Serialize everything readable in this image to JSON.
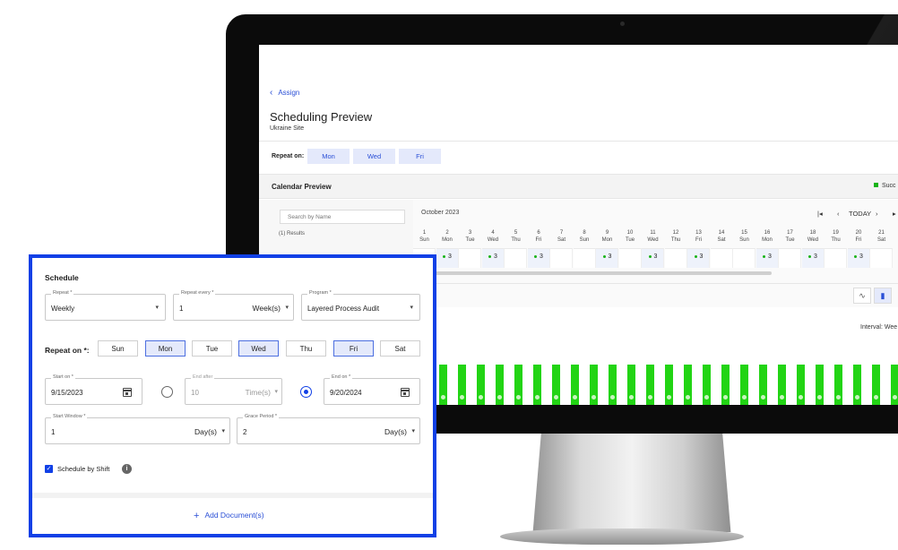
{
  "screen": {
    "back_link": "Assign",
    "title": "Scheduling Preview",
    "subtitle": "Ukraine Site",
    "repeat_label": "Repeat on:",
    "repeat_days": [
      "Mon",
      "Wed",
      "Fri"
    ],
    "calendar_preview_title": "Calendar Preview",
    "legend": "Succ",
    "search_placeholder": "Search by Name",
    "results": "(1) Results",
    "month": "October 2023",
    "today": "TODAY",
    "days": [
      {
        "n": "1",
        "w": "Sun",
        "c": ""
      },
      {
        "n": "2",
        "w": "Mon",
        "c": "3"
      },
      {
        "n": "3",
        "w": "Tue",
        "c": ""
      },
      {
        "n": "4",
        "w": "Wed",
        "c": "3"
      },
      {
        "n": "5",
        "w": "Thu",
        "c": ""
      },
      {
        "n": "6",
        "w": "Fri",
        "c": "3"
      },
      {
        "n": "7",
        "w": "Sat",
        "c": ""
      },
      {
        "n": "8",
        "w": "Sun",
        "c": ""
      },
      {
        "n": "9",
        "w": "Mon",
        "c": "3"
      },
      {
        "n": "10",
        "w": "Tue",
        "c": ""
      },
      {
        "n": "11",
        "w": "Wed",
        "c": "3"
      },
      {
        "n": "12",
        "w": "Thu",
        "c": ""
      },
      {
        "n": "13",
        "w": "Fri",
        "c": "3"
      },
      {
        "n": "14",
        "w": "Sat",
        "c": ""
      },
      {
        "n": "15",
        "w": "Sun",
        "c": ""
      },
      {
        "n": "16",
        "w": "Mon",
        "c": "3"
      },
      {
        "n": "17",
        "w": "Tue",
        "c": ""
      },
      {
        "n": "18",
        "w": "Wed",
        "c": "3"
      },
      {
        "n": "19",
        "w": "Thu",
        "c": ""
      },
      {
        "n": "20",
        "w": "Fri",
        "c": "3"
      },
      {
        "n": "21",
        "w": "Sat",
        "c": ""
      }
    ],
    "interval": "Interval: Wee",
    "bar_count": 25,
    "bar_color": "#22d414"
  },
  "schedule": {
    "title": "Schedule",
    "repeat": {
      "label": "Repeat *",
      "value": "Weekly"
    },
    "repeat_every": {
      "label": "Repeat every *",
      "value": "1",
      "unit": "Week(s)"
    },
    "program": {
      "label": "Program *",
      "value": "Layered Process Audit"
    },
    "repeat_on_label": "Repeat on *:",
    "days": [
      {
        "label": "Sun",
        "selected": false
      },
      {
        "label": "Mon",
        "selected": true
      },
      {
        "label": "Tue",
        "selected": false
      },
      {
        "label": "Wed",
        "selected": true
      },
      {
        "label": "Thu",
        "selected": false
      },
      {
        "label": "Fri",
        "selected": true
      },
      {
        "label": "Sat",
        "selected": false
      }
    ],
    "start_on": {
      "label": "Start on *",
      "value": "9/15/2023"
    },
    "end_after": {
      "label": "End after",
      "value": "10",
      "unit": "Time(s)"
    },
    "end_on": {
      "label": "End on *",
      "value": "9/20/2024"
    },
    "start_window": {
      "label": "Start Window *",
      "value": "1",
      "unit": "Day(s)"
    },
    "grace_period": {
      "label": "Grace Period *",
      "value": "2",
      "unit": "Day(s)"
    },
    "schedule_by_shift": "Schedule by Shift",
    "add_document": "Add Document(s)",
    "accent": "#1140e6"
  }
}
